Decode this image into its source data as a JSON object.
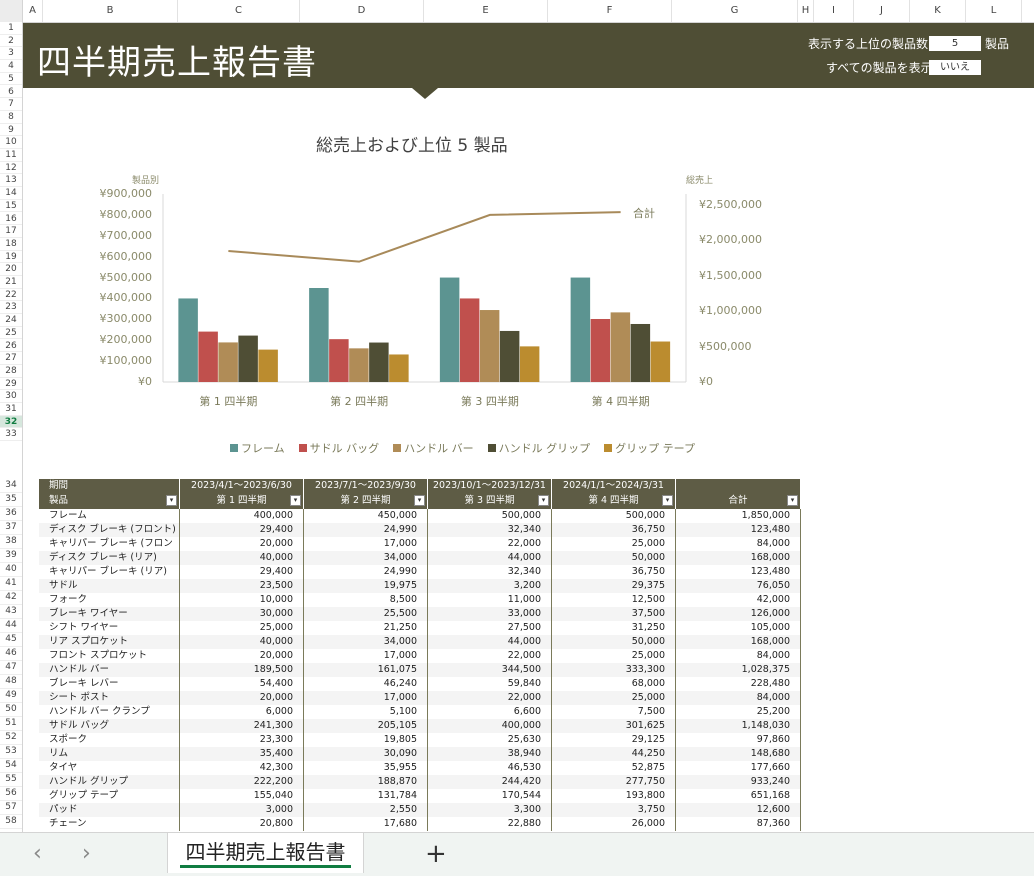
{
  "columns": [
    "A",
    "B",
    "C",
    "D",
    "E",
    "F",
    "G",
    "H",
    "I",
    "J",
    "K",
    "L"
  ],
  "rows_start": 1,
  "rows_end": 58,
  "selected_row": 32,
  "header": {
    "title": "四半期売上報告書",
    "top_n_label": "表示する上位の製品数:",
    "top_n_value": "5",
    "top_n_unit": "製品",
    "show_all_label": "すべての製品を表示:",
    "show_all_value": "いいえ"
  },
  "chart_data": {
    "type": "bar",
    "title": "総売上および上位  5 製品",
    "y_left_label": "製品別",
    "y_right_label": "総売上",
    "categories": [
      "第 1 四半期",
      "第 2 四半期",
      "第 3 四半期",
      "第 4 四半期"
    ],
    "ylim": [
      0,
      900000
    ],
    "y2lim": [
      0,
      2600000
    ],
    "yticks": [
      "¥0",
      "¥100,000",
      "¥200,000",
      "¥300,000",
      "¥400,000",
      "¥500,000",
      "¥600,000",
      "¥700,000",
      "¥800,000",
      "¥900,000"
    ],
    "y2ticks": [
      "¥0",
      "¥500,000",
      "¥1,000,000",
      "¥1,500,000",
      "¥2,000,000",
      "¥2,500,000"
    ],
    "series": [
      {
        "name": "フレーム",
        "color": "#5c9491",
        "values": [
          400000,
          450000,
          500000,
          500000
        ]
      },
      {
        "name": "サドル バッグ",
        "color": "#c0504d",
        "values": [
          241300,
          205105,
          400000,
          301625
        ]
      },
      {
        "name": "ハンドル バー",
        "color": "#b08c57",
        "values": [
          189500,
          161075,
          344500,
          333300
        ]
      },
      {
        "name": "ハンドル グリップ",
        "color": "#4f4e35",
        "values": [
          222200,
          188870,
          244420,
          277750
        ]
      },
      {
        "name": "グリップ テープ",
        "color": "#bb8c2f",
        "values": [
          155040,
          131784,
          170544,
          193800
        ]
      }
    ],
    "line": {
      "name": "合計",
      "color": "#a88a5a",
      "values": [
        1850000,
        1700000,
        2360000,
        2400000
      ]
    }
  },
  "table": {
    "period_label": "期間",
    "product_label": "製品",
    "periods": [
      "2023/4/1～2023/6/30",
      "2023/7/1～2023/9/30",
      "2023/10/1～2023/12/31",
      "2024/1/1～2024/3/31"
    ],
    "quarters": [
      "第 1 四半期",
      "第 2 四半期",
      "第 3 四半期",
      "第 4 四半期"
    ],
    "total_label": "合計",
    "rows": [
      [
        "フレーム",
        "400,000",
        "450,000",
        "500,000",
        "500,000",
        "1,850,000"
      ],
      [
        "ディスク ブレーキ (フロント)",
        "29,400",
        "24,990",
        "32,340",
        "36,750",
        "123,480"
      ],
      [
        "キャリパー ブレーキ (フロント)",
        "20,000",
        "17,000",
        "22,000",
        "25,000",
        "84,000"
      ],
      [
        "ディスク ブレーキ (リア)",
        "40,000",
        "34,000",
        "44,000",
        "50,000",
        "168,000"
      ],
      [
        "キャリパー ブレーキ (リア)",
        "29,400",
        "24,990",
        "32,340",
        "36,750",
        "123,480"
      ],
      [
        "サドル",
        "23,500",
        "19,975",
        "3,200",
        "29,375",
        "76,050"
      ],
      [
        "フォーク",
        "10,000",
        "8,500",
        "11,000",
        "12,500",
        "42,000"
      ],
      [
        "ブレーキ ワイヤー",
        "30,000",
        "25,500",
        "33,000",
        "37,500",
        "126,000"
      ],
      [
        "シフト ワイヤー",
        "25,000",
        "21,250",
        "27,500",
        "31,250",
        "105,000"
      ],
      [
        "リア スプロケット",
        "40,000",
        "34,000",
        "44,000",
        "50,000",
        "168,000"
      ],
      [
        "フロント スプロケット",
        "20,000",
        "17,000",
        "22,000",
        "25,000",
        "84,000"
      ],
      [
        "ハンドル バー",
        "189,500",
        "161,075",
        "344,500",
        "333,300",
        "1,028,375"
      ],
      [
        "ブレーキ レバー",
        "54,400",
        "46,240",
        "59,840",
        "68,000",
        "228,480"
      ],
      [
        "シート ポスト",
        "20,000",
        "17,000",
        "22,000",
        "25,000",
        "84,000"
      ],
      [
        "ハンドル バー クランプ",
        "6,000",
        "5,100",
        "6,600",
        "7,500",
        "25,200"
      ],
      [
        "サドル バッグ",
        "241,300",
        "205,105",
        "400,000",
        "301,625",
        "1,148,030"
      ],
      [
        "スポーク",
        "23,300",
        "19,805",
        "25,630",
        "29,125",
        "97,860"
      ],
      [
        "リム",
        "35,400",
        "30,090",
        "38,940",
        "44,250",
        "148,680"
      ],
      [
        "タイヤ",
        "42,300",
        "35,955",
        "46,530",
        "52,875",
        "177,660"
      ],
      [
        "ハンドル グリップ",
        "222,200",
        "188,870",
        "244,420",
        "277,750",
        "933,240"
      ],
      [
        "グリップ テープ",
        "155,040",
        "131,784",
        "170,544",
        "193,800",
        "651,168"
      ],
      [
        "パッド",
        "3,000",
        "2,550",
        "3,300",
        "3,750",
        "12,600"
      ],
      [
        "チェーン",
        "20,800",
        "17,680",
        "22,880",
        "26,000",
        "87,360"
      ]
    ]
  },
  "tabs": {
    "prev": "‹",
    "next": "›",
    "active": "四半期売上報告書",
    "add": "+"
  }
}
